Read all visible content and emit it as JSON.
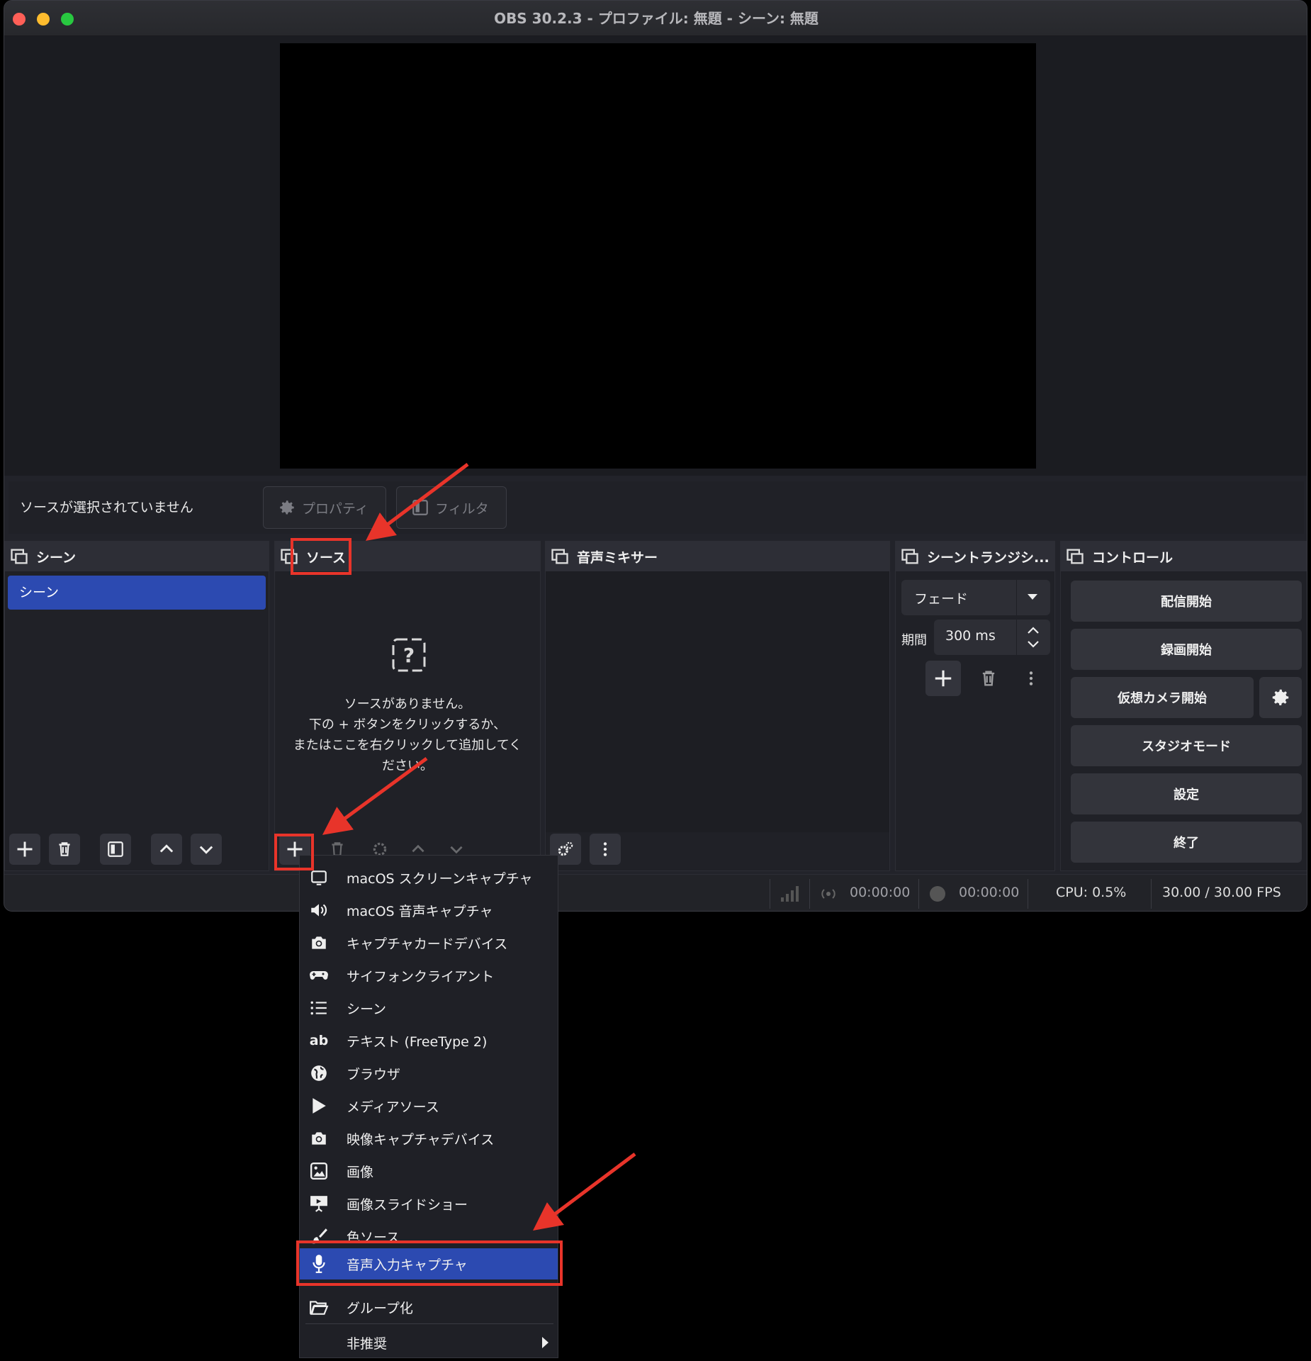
{
  "window": {
    "title": "OBS 30.2.3 - プロファイル: 無題 - シーン: 無題"
  },
  "source_toolbar": {
    "no_source": "ソースが選択されていません",
    "properties": "プロパティ",
    "filters": "フィルタ"
  },
  "docks": {
    "scenes": {
      "title": "シーン",
      "items": [
        "シーン"
      ]
    },
    "sources": {
      "title": "ソース",
      "empty_line1": "ソースがありません。",
      "empty_line2": "下の + ボタンをクリックするか、",
      "empty_line3": "またはここを右クリックして追加してく",
      "empty_line4": "ださい。"
    },
    "mixer": {
      "title": "音声ミキサー"
    },
    "transitions": {
      "title": "シーントランジシ...",
      "type": "フェード",
      "duration_label": "期間",
      "duration": "300 ms"
    },
    "controls": {
      "title": "コントロール",
      "start_stream": "配信開始",
      "start_record": "録画開始",
      "start_vcam": "仮想カメラ開始",
      "studio_mode": "スタジオモード",
      "settings": "設定",
      "exit": "終了"
    }
  },
  "status": {
    "stream_time": "00:00:00",
    "rec_time": "00:00:00",
    "cpu": "CPU: 0.5%",
    "fps": "30.00 / 30.00 FPS"
  },
  "add_source_menu": {
    "items": [
      {
        "label": "macOS スクリーンキャプチャ",
        "icon": "monitor-icon"
      },
      {
        "label": "macOS 音声キャプチャ",
        "icon": "speaker-icon"
      },
      {
        "label": "キャプチャカードデバイス",
        "icon": "camera-icon"
      },
      {
        "label": "サイフォンクライアント",
        "icon": "gamepad-icon"
      },
      {
        "label": "シーン",
        "icon": "list-icon"
      },
      {
        "label": "テキスト (FreeType 2)",
        "icon": "text-ab-icon"
      },
      {
        "label": "ブラウザ",
        "icon": "globe-icon"
      },
      {
        "label": "メディアソース",
        "icon": "play-icon"
      },
      {
        "label": "映像キャプチャデバイス",
        "icon": "camera-icon"
      },
      {
        "label": "画像",
        "icon": "image-icon"
      },
      {
        "label": "画像スライドショー",
        "icon": "slideshow-icon"
      },
      {
        "label": "色ソース",
        "icon": "brush-icon"
      },
      {
        "label": "音声入力キャプチャ",
        "icon": "microphone-icon"
      },
      {
        "label": "グループ化",
        "icon": "folder-icon"
      },
      {
        "label": "非推奨",
        "icon": "submenu-arrow-icon"
      }
    ],
    "selected": "音声入力キャプチャ"
  },
  "colors": {
    "accent_blue": "#2c4ab1",
    "annotation_red": "#e8342a",
    "traffic_red": "#ff5f57",
    "traffic_yellow": "#febc2e",
    "traffic_green": "#28c840"
  }
}
